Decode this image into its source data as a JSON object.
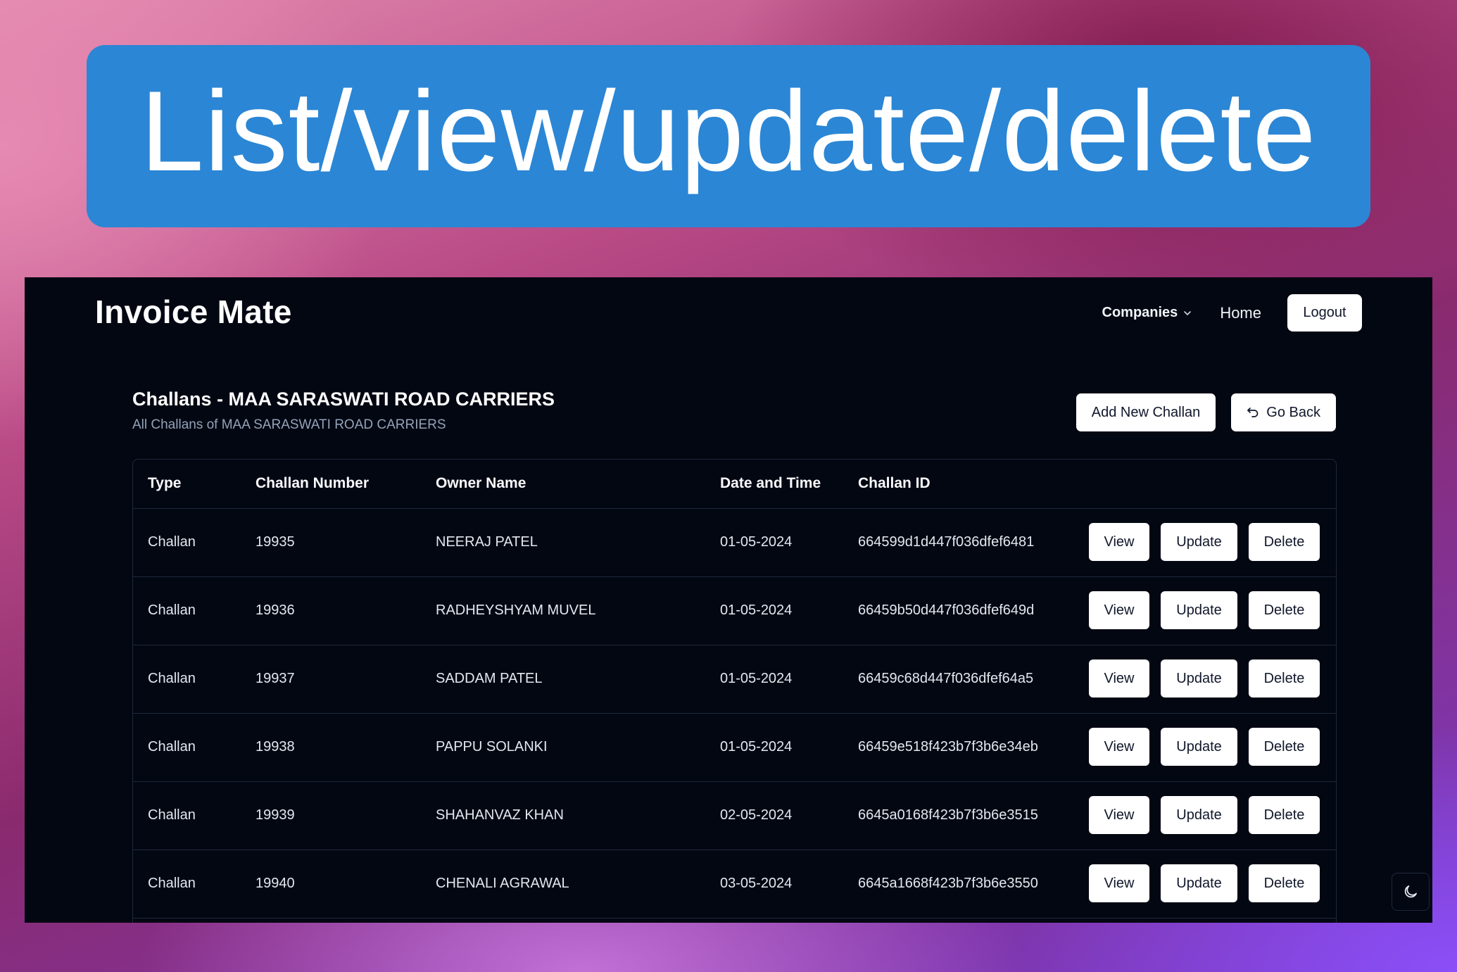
{
  "banner": {
    "title": "List/view/update/delete"
  },
  "navbar": {
    "brand": "Invoice Mate",
    "companies_label": "Companies",
    "home_label": "Home",
    "logout_label": "Logout"
  },
  "page": {
    "title": "Challans - MAA SARASWATI ROAD CARRIERS",
    "subtitle": "All Challans of  MAA SARASWATI ROAD CARRIERS",
    "add_button": "Add New Challan",
    "back_button": "Go Back"
  },
  "table": {
    "headers": [
      "Type",
      "Challan Number",
      "Owner Name",
      "Date and Time",
      "Challan ID"
    ],
    "action_labels": {
      "view": "View",
      "update": "Update",
      "delete": "Delete"
    },
    "rows": [
      {
        "type": "Challan",
        "number": "19935",
        "owner": "NEERAJ PATEL",
        "date": "01-05-2024",
        "id": "664599d1d447f036dfef6481"
      },
      {
        "type": "Challan",
        "number": "19936",
        "owner": "RADHEYSHYAM MUVEL",
        "date": "01-05-2024",
        "id": "66459b50d447f036dfef649d"
      },
      {
        "type": "Challan",
        "number": "19937",
        "owner": "SADDAM PATEL",
        "date": "01-05-2024",
        "id": "66459c68d447f036dfef64a5"
      },
      {
        "type": "Challan",
        "number": "19938",
        "owner": "PAPPU SOLANKI",
        "date": "01-05-2024",
        "id": "66459e518f423b7f3b6e34eb"
      },
      {
        "type": "Challan",
        "number": "19939",
        "owner": "SHAHANVAZ KHAN",
        "date": "02-05-2024",
        "id": "6645a0168f423b7f3b6e3515"
      },
      {
        "type": "Challan",
        "number": "19940",
        "owner": "CHENALI AGRAWAL",
        "date": "03-05-2024",
        "id": "6645a1668f423b7f3b6e3550"
      }
    ]
  },
  "icons": {
    "companies_caret": "chevron-down-icon",
    "go_back": "undo-icon",
    "theme_toggle": "moon-icon"
  },
  "colors": {
    "banner": "#2b86d5",
    "app_background": "#030712",
    "button_background": "#ffffff",
    "border": "#1e293b"
  }
}
